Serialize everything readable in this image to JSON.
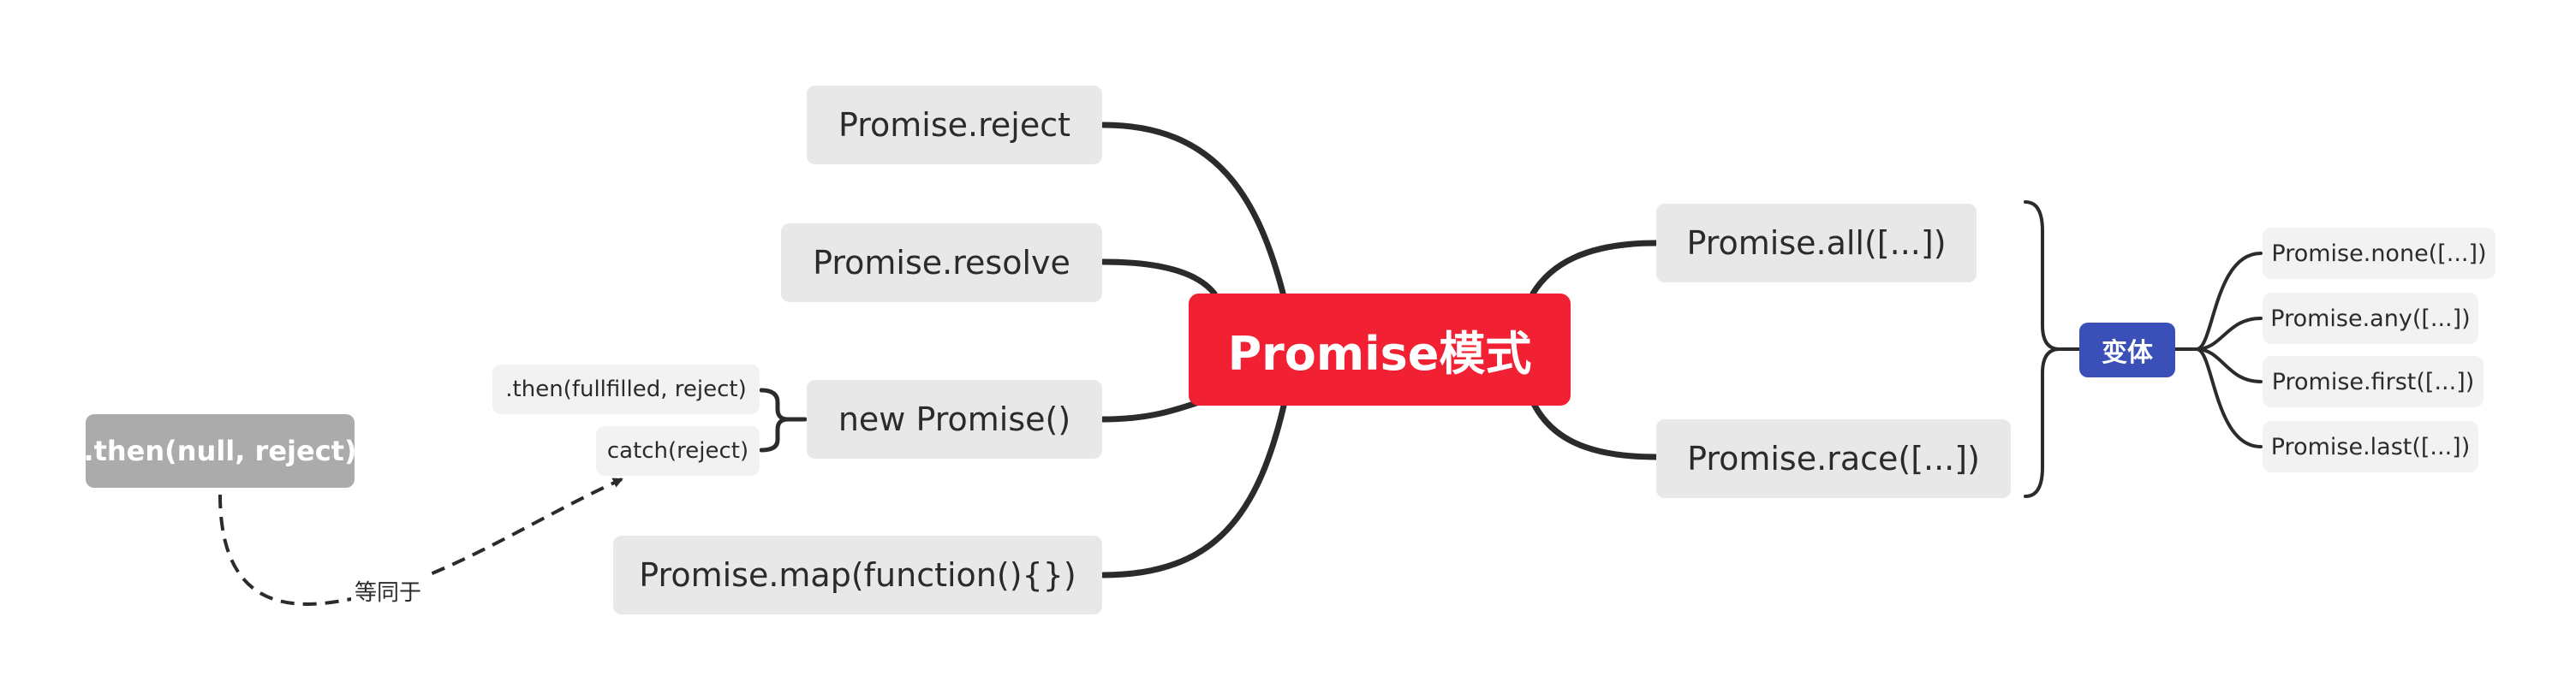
{
  "central": {
    "label": "Promise模式",
    "color": "#f22033"
  },
  "left_topics": [
    {
      "label": "Promise.reject"
    },
    {
      "label": "Promise.resolve"
    },
    {
      "label": "new Promise()"
    },
    {
      "label": "Promise.map(function(){})"
    }
  ],
  "new_promise_children": [
    {
      "label": ".then(fullfilled, reject)"
    },
    {
      "label": "catch(reject)"
    }
  ],
  "right_topics": [
    {
      "label": "Promise.all([...])"
    },
    {
      "label": "Promise.race([...])"
    }
  ],
  "summary": {
    "label": "变体",
    "color": "#3b4fb8",
    "items": [
      {
        "label": "Promise.none([...])"
      },
      {
        "label": "Promise.any([...])"
      },
      {
        "label": "Promise.first([...])"
      },
      {
        "label": "Promise.last([...])"
      }
    ]
  },
  "floating_topic": {
    "label": ".then(null, reject)"
  },
  "relationship": {
    "label": "等同于"
  }
}
